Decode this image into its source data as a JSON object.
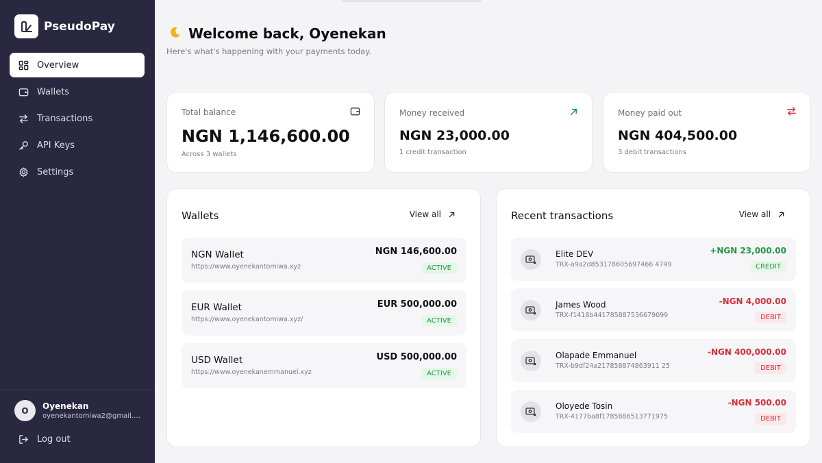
{
  "app": {
    "name": "PseudoPay"
  },
  "sidebar": {
    "items": [
      {
        "label": "Overview",
        "icon": "grid-icon",
        "active": true
      },
      {
        "label": "Wallets",
        "icon": "wallet-icon"
      },
      {
        "label": "Transactions",
        "icon": "arrows-icon"
      },
      {
        "label": "API Keys",
        "icon": "key-icon"
      },
      {
        "label": "Settings",
        "icon": "gear-icon"
      }
    ],
    "user": {
      "initial": "O",
      "name": "Oyenekan",
      "email": "oyenekantomiwa2@gmail.c..."
    },
    "logout_label": "Log out"
  },
  "header": {
    "icon": "moon-icon",
    "title": "Welcome back, Oyenekan",
    "subtitle": "Here's what's happening with your payments today."
  },
  "stats": {
    "total_balance": {
      "label": "Total balance",
      "value": "NGN 1,146,600.00",
      "sub": "Across 3 wallets"
    },
    "money_received": {
      "label": "Money received",
      "value": "NGN 23,000.00",
      "sub": "1 credit transaction"
    },
    "money_paid_out": {
      "label": "Money paid out",
      "value": "NGN 404,500.00",
      "sub": "3 debit transactions"
    }
  },
  "wallets_panel": {
    "title": "Wallets",
    "view_all": "View all",
    "items": [
      {
        "name": "NGN Wallet",
        "url": "https://www.oyenekantomiwa.xyz",
        "amount": "NGN 146,600.00",
        "status": "ACTIVE"
      },
      {
        "name": "EUR Wallet",
        "url": "https://www.oyenekantomiwa.xyz/",
        "amount": "EUR 500,000.00",
        "status": "ACTIVE"
      },
      {
        "name": "USD Wallet",
        "url": "https://www.oyenekanemmanuel.xyz",
        "amount": "USD 500,000.00",
        "status": "ACTIVE"
      }
    ]
  },
  "transactions_panel": {
    "title": "Recent transactions",
    "view_all": "View all",
    "items": [
      {
        "name": "Elite DEV",
        "id": "TRX-a9a2d853178605697466 4749",
        "amount": "+NGN 23,000.00",
        "type": "CREDIT"
      },
      {
        "name": "James Wood",
        "id": "TRX-f1418b441785887536679099",
        "amount": "-NGN 4,000.00",
        "type": "DEBIT"
      },
      {
        "name": "Olapade Emmanuel",
        "id": "TRX-b9df24a217858874863911 25",
        "amount": "-NGN 400,000.00",
        "type": "DEBIT"
      },
      {
        "name": "Oloyede Tosin",
        "id": "TRX-4177ba8f1785886513771975",
        "amount": "-NGN 500.00",
        "type": "DEBIT"
      }
    ]
  },
  "colors": {
    "sidebar_bg": "#2a2740",
    "credit": "#1f9a45",
    "debit": "#d6303a"
  }
}
